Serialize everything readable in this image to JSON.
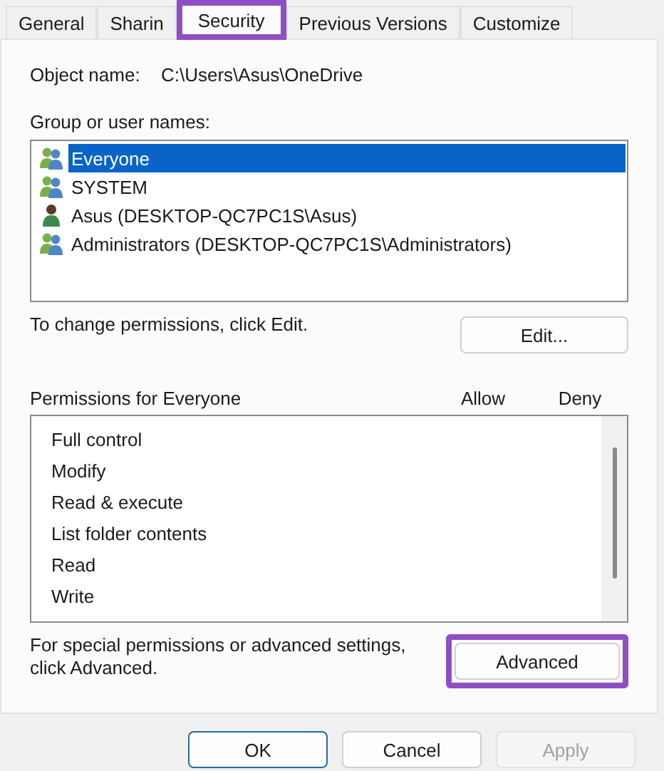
{
  "tabs": [
    {
      "label": "General",
      "selected": false,
      "highlighted": false
    },
    {
      "label": "Sharin",
      "selected": false,
      "highlighted": false
    },
    {
      "label": "Security",
      "selected": true,
      "highlighted": true
    },
    {
      "label": "Previous Versions",
      "selected": false,
      "highlighted": false
    },
    {
      "label": "Customize",
      "selected": false,
      "highlighted": false
    }
  ],
  "object_name": {
    "label": "Object name:",
    "value": "C:\\Users\\Asus\\OneDrive"
  },
  "groups": {
    "label": "Group or user names:",
    "items": [
      {
        "name": "Everyone",
        "kind": "group",
        "selected": true
      },
      {
        "name": "SYSTEM",
        "kind": "group",
        "selected": false
      },
      {
        "name": "Asus (DESKTOP-QC7PC1S\\Asus)",
        "kind": "user",
        "selected": false
      },
      {
        "name": "Administrators (DESKTOP-QC7PC1S\\Administrators)",
        "kind": "group",
        "selected": false
      }
    ]
  },
  "edit_hint": "To change permissions, click Edit.",
  "edit_button": {
    "label": "Edit..."
  },
  "permissions": {
    "label": "Permissions for Everyone",
    "columns": [
      "Allow",
      "Deny"
    ],
    "items": [
      "Full control",
      "Modify",
      "Read & execute",
      "List folder contents",
      "Read",
      "Write"
    ]
  },
  "advanced_hint": "For special permissions or advanced settings, click Advanced.",
  "advanced_button": {
    "label": "Advanced",
    "highlighted": true
  },
  "buttons": [
    {
      "label": "OK",
      "kind": "default",
      "disabled": false
    },
    {
      "label": "Cancel",
      "kind": "normal",
      "disabled": false
    },
    {
      "label": "Apply",
      "kind": "normal",
      "disabled": true
    }
  ]
}
